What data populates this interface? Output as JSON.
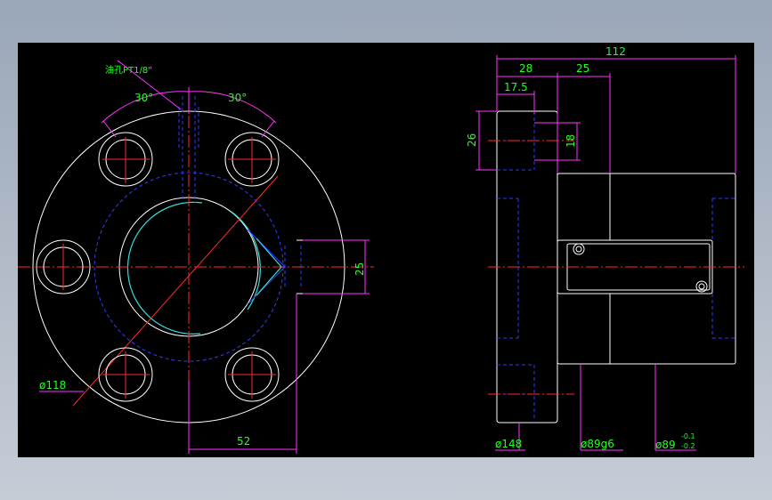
{
  "dims": {
    "d112": "112",
    "d28": "28",
    "d25_top": "25",
    "d17_5": "17.5",
    "d26": "26",
    "d18": "18",
    "d25_side": "25",
    "d52": "52",
    "d30_left": "30°",
    "d30_right": "30°",
    "dia118": "ø118",
    "dia148": "ø148",
    "dia89g6": "ø89g6",
    "dia89": "ø89",
    "tol_upper": "-0.1",
    "tol_lower": "-0.2",
    "note_oil": "油孔PT1/8\""
  },
  "colors": {
    "background": "#000000",
    "outline": "#ffffff",
    "hidden": "#2f3dff",
    "center": "#ff2a2a",
    "dimension_line": "#ff33ff",
    "dimension_text": "#22ff22"
  }
}
